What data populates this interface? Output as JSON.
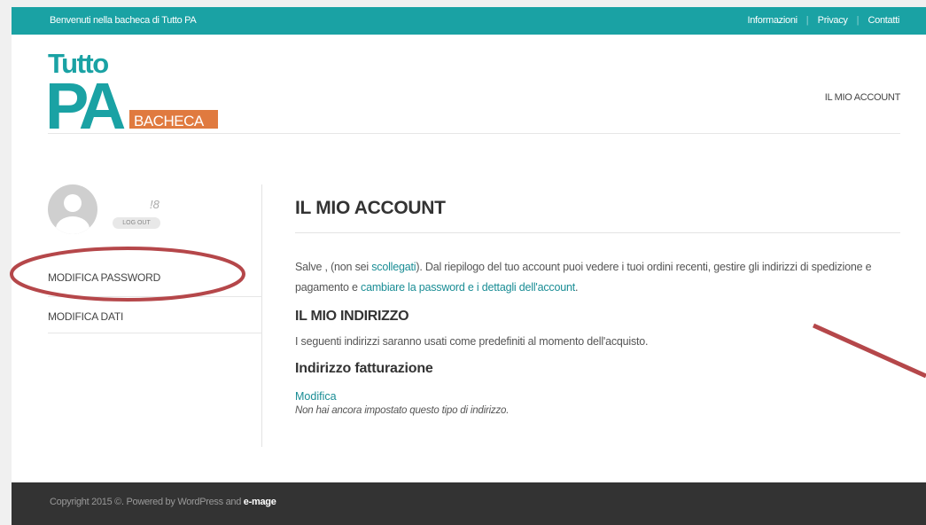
{
  "topbar": {
    "welcome": "Benvenuti nella bacheca di Tutto PA",
    "links": [
      "Informazioni",
      "Privacy",
      "Contatti"
    ]
  },
  "header": {
    "logo_tutto": "Tutto",
    "logo_pa": "PA",
    "logo_bacheca": "BACHECA",
    "nav_account": "IL MIO ACCOUNT"
  },
  "sidebar": {
    "username": "!8",
    "logout": "LOG OUT",
    "items": [
      "MODIFICA PASSWORD",
      "MODIFICA DATI"
    ]
  },
  "main": {
    "title": "IL MIO ACCOUNT",
    "intro_part1": "Salve ,       (non sei ",
    "intro_link1": "scollegati",
    "intro_part2": "). Dal riepilogo del tuo account puoi vedere i tuoi ordini recenti, gestire gli indirizzi di spedizione e pagamento e ",
    "intro_link2": "cambiare la password e i dettagli dell'account",
    "intro_end": ".",
    "address_title": "IL MIO INDIRIZZO",
    "address_desc": "I seguenti indirizzi saranno usati come predefiniti al momento dell'acquisto.",
    "billing_title": "Indirizzo fatturazione",
    "edit_link": "Modifica",
    "no_address": "Non hai ancora impostato questo tipo di indirizzo."
  },
  "footer": {
    "copy": "Copyright 2015 ©. Powered by WordPress and ",
    "brand": "e-mage"
  },
  "colors": {
    "teal": "#1aa2a4",
    "orange": "#e07a3f",
    "annotation": "#b5474a",
    "footer_bg": "#333333"
  }
}
